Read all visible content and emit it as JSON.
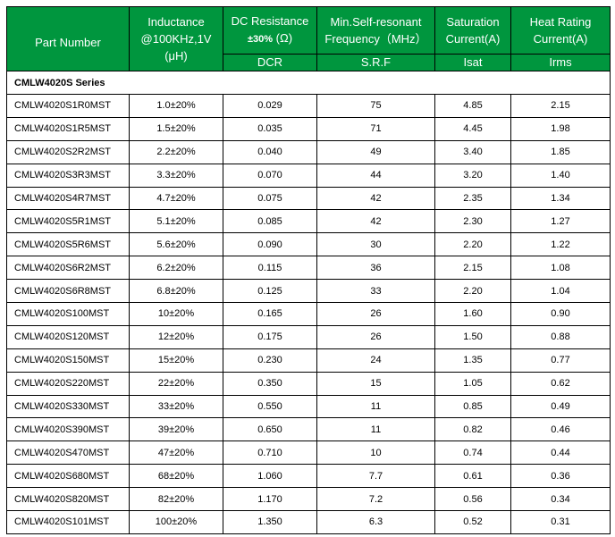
{
  "header": {
    "part_number": "Part Number",
    "inductance": [
      "Inductance",
      "@100KHz,1V",
      "(μH)"
    ],
    "dc_resistance": [
      "DC Resistance",
      "±30%",
      " (Ω)",
      "DCR"
    ],
    "srf": [
      "Min.Self-resonant",
      "Frequency（MHz）",
      "S.R.F"
    ],
    "saturation": [
      "Saturation",
      "Current(A)",
      "Isat"
    ],
    "heat": [
      "Heat Rating",
      "Current(A)",
      "Irms"
    ]
  },
  "series_title": "CMLW4020S Series",
  "rows": [
    [
      "CMLW4020S1R0MST",
      "1.0±20%",
      "0.029",
      "75",
      "4.85",
      "2.15"
    ],
    [
      "CMLW4020S1R5MST",
      "1.5±20%",
      "0.035",
      "71",
      "4.45",
      "1.98"
    ],
    [
      "CMLW4020S2R2MST",
      "2.2±20%",
      "0.040",
      "49",
      "3.40",
      "1.85"
    ],
    [
      "CMLW4020S3R3MST",
      "3.3±20%",
      "0.070",
      "44",
      "3.20",
      "1.40"
    ],
    [
      "CMLW4020S4R7MST",
      "4.7±20%",
      "0.075",
      "42",
      "2.35",
      "1.34"
    ],
    [
      "CMLW4020S5R1MST",
      "5.1±20%",
      "0.085",
      "42",
      "2.30",
      "1.27"
    ],
    [
      "CMLW4020S5R6MST",
      "5.6±20%",
      "0.090",
      "30",
      "2.20",
      "1.22"
    ],
    [
      "CMLW4020S6R2MST",
      "6.2±20%",
      "0.115",
      "36",
      "2.15",
      "1.08"
    ],
    [
      "CMLW4020S6R8MST",
      "6.8±20%",
      "0.125",
      "33",
      "2.20",
      "1.04"
    ],
    [
      "CMLW4020S100MST",
      "10±20%",
      "0.165",
      "26",
      "1.60",
      "0.90"
    ],
    [
      "CMLW4020S120MST",
      "12±20%",
      "0.175",
      "26",
      "1.50",
      "0.88"
    ],
    [
      "CMLW4020S150MST",
      "15±20%",
      "0.230",
      "24",
      "1.35",
      "0.77"
    ],
    [
      "CMLW4020S220MST",
      "22±20%",
      "0.350",
      "15",
      "1.05",
      "0.62"
    ],
    [
      "CMLW4020S330MST",
      "33±20%",
      "0.550",
      "11",
      "0.85",
      "0.49"
    ],
    [
      "CMLW4020S390MST",
      "39±20%",
      "0.650",
      "11",
      "0.82",
      "0.46"
    ],
    [
      "CMLW4020S470MST",
      "47±20%",
      "0.710",
      "10",
      "0.74",
      "0.44"
    ],
    [
      "CMLW4020S680MST",
      "68±20%",
      "1.060",
      "7.7",
      "0.61",
      "0.36"
    ],
    [
      "CMLW4020S820MST",
      "82±20%",
      "1.170",
      "7.2",
      "0.56",
      "0.34"
    ],
    [
      "CMLW4020S101MST",
      "100±20%",
      "1.350",
      "6.3",
      "0.52",
      "0.31"
    ]
  ],
  "colors": {
    "header_bg": "#00963e",
    "header_text": "#ffffff",
    "border": "#000000"
  }
}
